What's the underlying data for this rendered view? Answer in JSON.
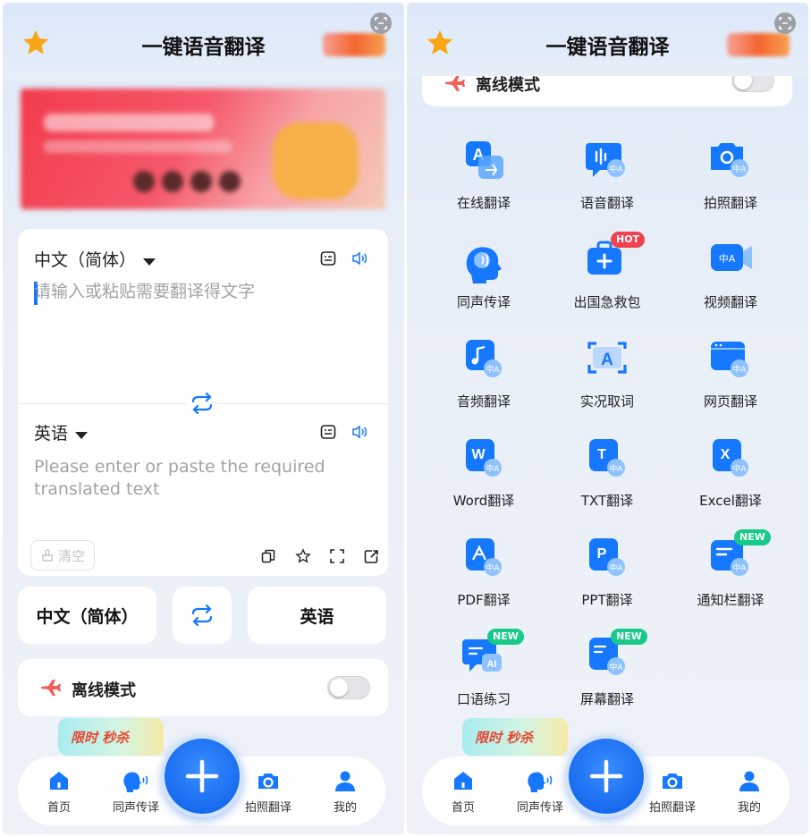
{
  "app": {
    "title": "一键语音翻译"
  },
  "translator": {
    "source_lang": "中文（简体）",
    "source_placeholder": "请输入或粘贴需要翻译得文字",
    "target_lang": "英语",
    "target_placeholder": "Please enter or paste the required translated text",
    "clear_label": "清空"
  },
  "lang_pair": {
    "source": "中文（简体）",
    "target": "英语"
  },
  "offline": {
    "label": "离线模式",
    "enabled": false
  },
  "flash_sale": {
    "label": "限时 秒杀"
  },
  "features": [
    {
      "label": "在线翻译",
      "icon": "translate-icon",
      "badge": ""
    },
    {
      "label": "语音翻译",
      "icon": "voice-translate-icon",
      "badge": ""
    },
    {
      "label": "拍照翻译",
      "icon": "camera-translate-icon",
      "badge": ""
    },
    {
      "label": "同声传译",
      "icon": "simultaneous-interpret-icon",
      "badge": ""
    },
    {
      "label": "出国急救包",
      "icon": "first-aid-kit-icon",
      "badge": "HOT"
    },
    {
      "label": "视频翻译",
      "icon": "video-translate-icon",
      "badge": ""
    },
    {
      "label": "音频翻译",
      "icon": "audio-translate-icon",
      "badge": ""
    },
    {
      "label": "实况取词",
      "icon": "live-capture-icon",
      "badge": ""
    },
    {
      "label": "网页翻译",
      "icon": "webpage-translate-icon",
      "badge": ""
    },
    {
      "label": "Word翻译",
      "icon": "word-file-icon",
      "badge": ""
    },
    {
      "label": "TXT翻译",
      "icon": "txt-file-icon",
      "badge": ""
    },
    {
      "label": "Excel翻译",
      "icon": "excel-file-icon",
      "badge": ""
    },
    {
      "label": "PDF翻译",
      "icon": "pdf-file-icon",
      "badge": ""
    },
    {
      "label": "PPT翻译",
      "icon": "ppt-file-icon",
      "badge": ""
    },
    {
      "label": "通知栏翻译",
      "icon": "notification-translate-icon",
      "badge": "NEW"
    },
    {
      "label": "口语练习",
      "icon": "speaking-practice-icon",
      "badge": "NEW"
    },
    {
      "label": "屏幕翻译",
      "icon": "screen-translate-icon",
      "badge": "NEW"
    }
  ],
  "nav": {
    "home": "首页",
    "interpret": "同声传译",
    "photo": "拍照翻译",
    "mine": "我的"
  },
  "colors": {
    "accent": "#1677ff",
    "hot": "#f2414f",
    "new": "#18c98a"
  }
}
